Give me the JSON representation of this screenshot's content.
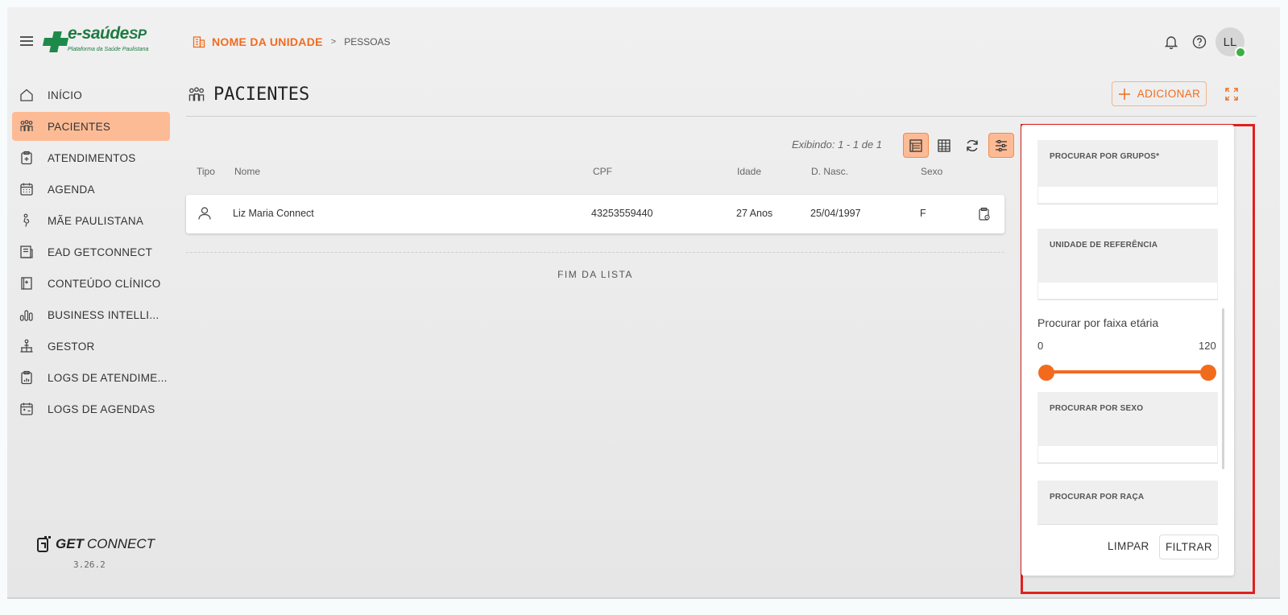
{
  "header": {
    "logo": {
      "brand": "e-saúde",
      "brand_suffix": "SP",
      "tagline": "Plataforma da Saúde Paulistana"
    },
    "breadcrumb": {
      "unit": "NOME DA UNIDADE",
      "separator": ">",
      "page": "PESSOAS"
    },
    "user_initials": "LL",
    "icons": [
      "menu-icon",
      "bell-icon",
      "help-icon"
    ]
  },
  "sidebar": {
    "items": [
      {
        "label": "INÍCIO",
        "icon": "home-icon",
        "active": false
      },
      {
        "label": "PACIENTES",
        "icon": "patients-icon",
        "active": true
      },
      {
        "label": "ATENDIMENTOS",
        "icon": "clipboard-icon",
        "active": false
      },
      {
        "label": "AGENDA",
        "icon": "calendar-icon",
        "active": false
      },
      {
        "label": "MÃE PAULISTANA",
        "icon": "pregnant-icon",
        "active": false
      },
      {
        "label": "EAD GETCONNECT",
        "icon": "education-icon",
        "active": false
      },
      {
        "label": "CONTEÚDO CLÍNICO",
        "icon": "book-icon",
        "active": false
      },
      {
        "label": "BUSINESS INTELLI...",
        "icon": "chart-icon",
        "active": false
      },
      {
        "label": "GESTOR",
        "icon": "manager-icon",
        "active": false
      },
      {
        "label": "LOGS DE ATENDIME...",
        "icon": "log-clipboard-icon",
        "active": false
      },
      {
        "label": "LOGS DE AGENDAS",
        "icon": "log-calendar-icon",
        "active": false
      }
    ],
    "footer_brand_bold": "GET",
    "footer_brand_light": "CONNECT",
    "version": "3.26.2"
  },
  "main": {
    "title": "PACIENTES",
    "add_label": "ADICIONAR",
    "showing": "Exibindo: 1 - 1 de 1",
    "columns": {
      "tipo": "Tipo",
      "nome": "Nome",
      "cpf": "CPF",
      "idade": "Idade",
      "nasc": "D. Nasc.",
      "sexo": "Sexo"
    },
    "rows": [
      {
        "nome": "Liz Maria Connect",
        "cpf": "43253559440",
        "idade": "27 Anos",
        "nasc": "25/04/1997",
        "sexo": "F"
      }
    ],
    "end_of_list": "FIM DA LISTA"
  },
  "filters": {
    "groups_label": "PROCURAR POR GRUPOS*",
    "unit_label": "UNIDADE DE REFERÊNCIA",
    "age_title": "Procurar por faixa etária",
    "age_min": "0",
    "age_max": "120",
    "age_range": [
      0,
      120
    ],
    "sex_label": "PROCURAR POR SEXO",
    "race_label": "PROCURAR POR RAÇA",
    "clear_label": "LIMPAR",
    "filter_label": "FILTRAR"
  },
  "colors": {
    "accent": "#f26b1d",
    "active_bg": "#fdbb95",
    "brand_green": "#1e7a42",
    "highlight": "#e02020"
  }
}
